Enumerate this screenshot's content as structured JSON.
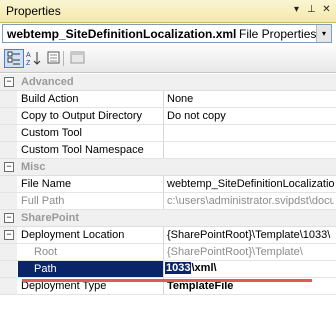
{
  "window": {
    "title": "Properties",
    "pin_glyph": "⊥",
    "close_glyph": "✕",
    "menu_glyph": "▾"
  },
  "selector": {
    "object_name": "webtemp_SiteDefinitionLocalization.xml",
    "object_type": "File Properties",
    "arrow": "▾"
  },
  "grid": {
    "advanced": {
      "label": "Advanced",
      "expander": "−",
      "build_action": {
        "name": "Build Action",
        "value": "None"
      },
      "copy_output": {
        "name": "Copy to Output Directory",
        "value": "Do not copy"
      },
      "custom_tool": {
        "name": "Custom Tool",
        "value": ""
      },
      "custom_tool_ns": {
        "name": "Custom Tool Namespace",
        "value": ""
      }
    },
    "misc": {
      "label": "Misc",
      "expander": "−",
      "file_name": {
        "name": "File Name",
        "value": "webtemp_SiteDefinitionLocalization"
      },
      "full_path": {
        "name": "Full Path",
        "value": "c:\\users\\administrator.svipdst\\docu"
      }
    },
    "sharepoint": {
      "label": "SharePoint",
      "expander": "−",
      "deployment_location": {
        "name": "Deployment Location",
        "value": "{SharePointRoot}\\Template\\1033\\",
        "expander": "−"
      },
      "root": {
        "name": "Root",
        "value": "{SharePointRoot}\\Template\\"
      },
      "path": {
        "name": "Path",
        "value_selected": "1033",
        "value_rest": "\\xml\\"
      },
      "deployment_type": {
        "name": "Deployment Type",
        "value": "TemplateFile"
      }
    }
  },
  "colors": {
    "selection": "#0a246a",
    "highlight_underline": "#e05a5a",
    "category_text": "#9a9a9a"
  }
}
